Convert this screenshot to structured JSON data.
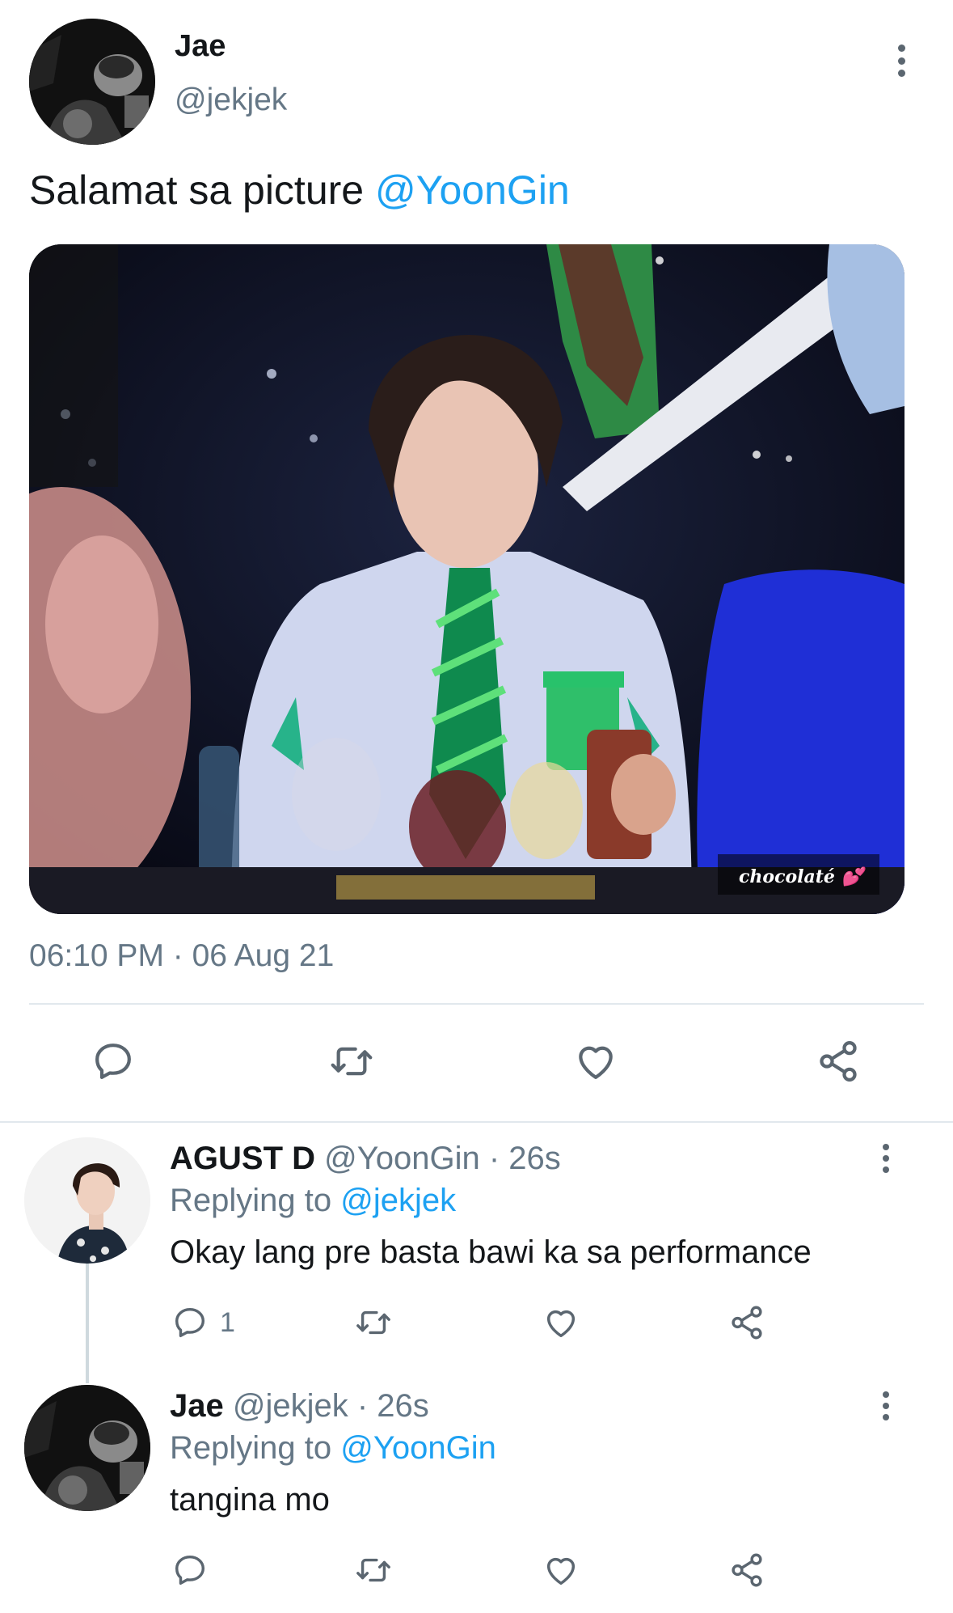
{
  "tweet": {
    "author_name": "Jae",
    "author_handle": "@jekjek",
    "text_prefix": "Salamat sa picture ",
    "text_mention": "@YoonGin",
    "image_watermark": "chocolaté 💕",
    "timestamp": "06:10 PM · 06 Aug 21"
  },
  "replies": [
    {
      "name": "AGUST D",
      "handle_time": " @YoonGin · 26s",
      "replying_prefix": "Replying to ",
      "replying_mention": "@jekjek",
      "text": "Okay lang pre basta bawi ka sa performance",
      "reply_count": "1"
    },
    {
      "name": "Jae",
      "handle_time": " @jekjek · 26s",
      "replying_prefix": "Replying to ",
      "replying_mention": "@YoonGin",
      "text": "tangina mo"
    }
  ],
  "colors": {
    "accent": "#1da1f2",
    "secondary_text": "#657786",
    "icon": "#5b6670",
    "divider": "#e1e8ed"
  },
  "icons": [
    "more-icon",
    "comment-icon",
    "retweet-icon",
    "like-icon",
    "share-icon"
  ]
}
